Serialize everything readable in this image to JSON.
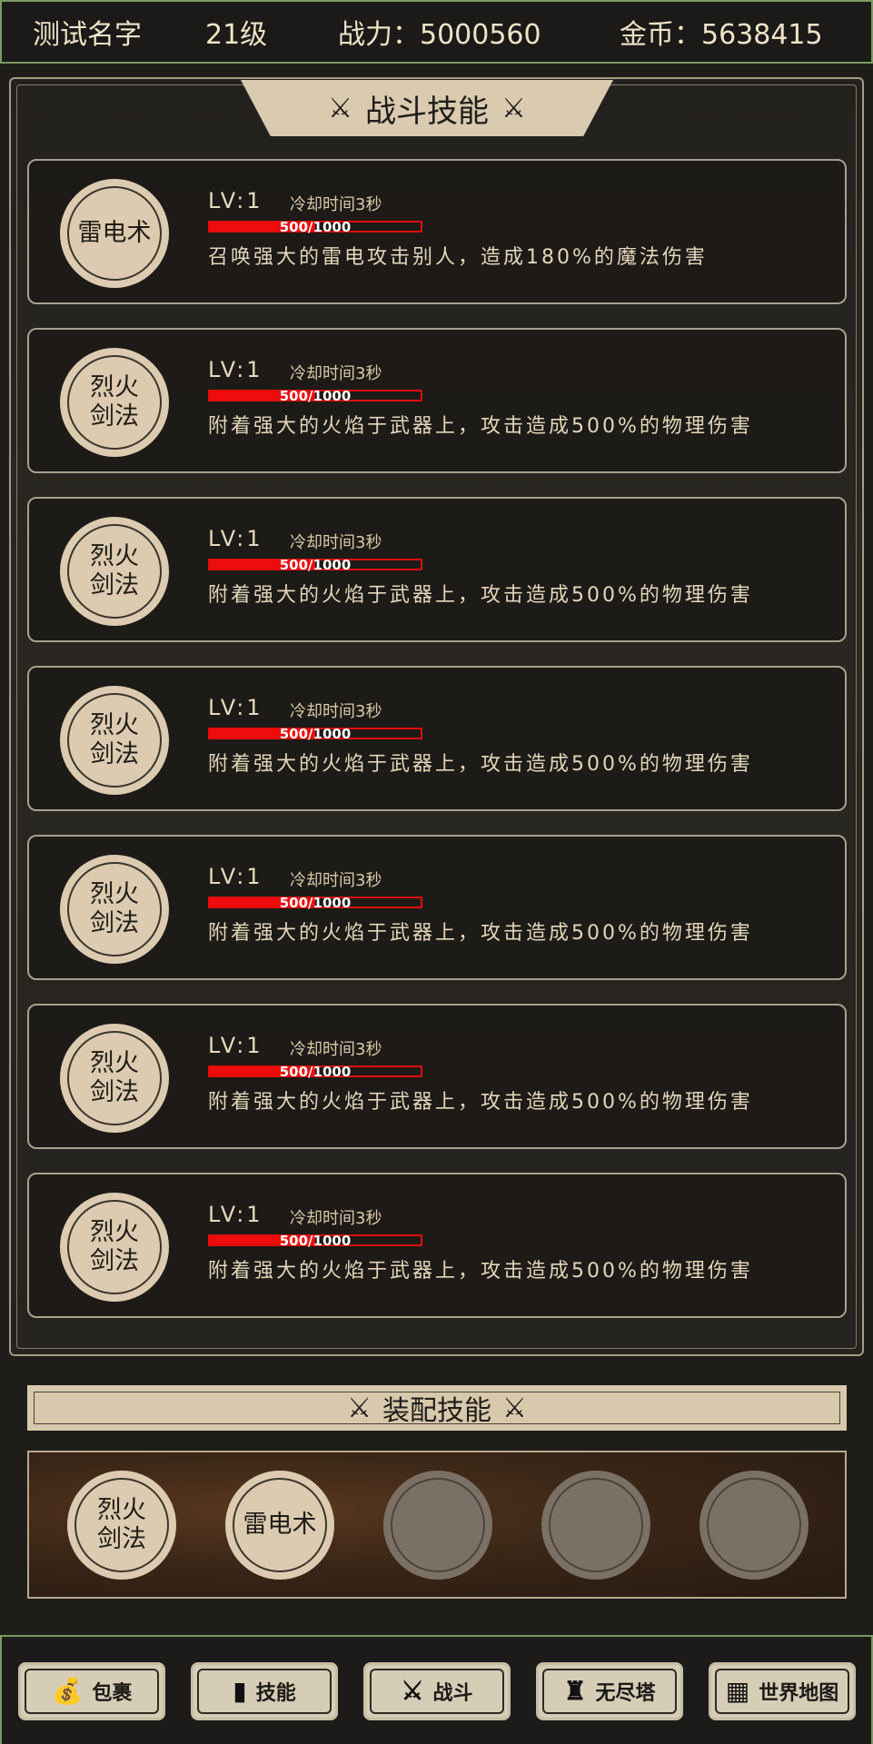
{
  "header": {
    "name": "测试名字",
    "level": "21级",
    "power": "战力：5000560",
    "gold": "金币：5638415"
  },
  "battle_skills": {
    "title": "战斗技能",
    "items": [
      {
        "icon_label": "雷电术",
        "level": "LV:1",
        "cooldown": "冷却时间3秒",
        "progress_text": "500/1000",
        "progress": 0.5,
        "description": "召唤强大的雷电攻击别人，造成180%的魔法伤害"
      },
      {
        "icon_label": "烈火剑法",
        "level": "LV:1",
        "cooldown": "冷却时间3秒",
        "progress_text": "500/1000",
        "progress": 0.5,
        "description": "附着强大的火焰于武器上，攻击造成500%的物理伤害"
      },
      {
        "icon_label": "烈火剑法",
        "level": "LV:1",
        "cooldown": "冷却时间3秒",
        "progress_text": "500/1000",
        "progress": 0.5,
        "description": "附着强大的火焰于武器上，攻击造成500%的物理伤害"
      },
      {
        "icon_label": "烈火剑法",
        "level": "LV:1",
        "cooldown": "冷却时间3秒",
        "progress_text": "500/1000",
        "progress": 0.5,
        "description": "附着强大的火焰于武器上，攻击造成500%的物理伤害"
      },
      {
        "icon_label": "烈火剑法",
        "level": "LV:1",
        "cooldown": "冷却时间3秒",
        "progress_text": "500/1000",
        "progress": 0.5,
        "description": "附着强大的火焰于武器上，攻击造成500%的物理伤害"
      },
      {
        "icon_label": "烈火剑法",
        "level": "LV:1",
        "cooldown": "冷却时间3秒",
        "progress_text": "500/1000",
        "progress": 0.5,
        "description": "附着强大的火焰于武器上，攻击造成500%的物理伤害"
      },
      {
        "icon_label": "烈火剑法",
        "level": "LV:1",
        "cooldown": "冷却时间3秒",
        "progress_text": "500/1000",
        "progress": 0.5,
        "description": "附着强大的火焰于武器上，攻击造成500%的物理伤害"
      }
    ]
  },
  "equipped": {
    "title": "装配技能",
    "slots": [
      {
        "label": "烈火剑法",
        "empty": false
      },
      {
        "label": "雷电术",
        "empty": false
      },
      {
        "label": "",
        "empty": true
      },
      {
        "label": "",
        "empty": true
      },
      {
        "label": "",
        "empty": true
      }
    ]
  },
  "nav": [
    {
      "label": "包裹",
      "icon": "bag-icon"
    },
    {
      "label": "技能",
      "icon": "book-icon"
    },
    {
      "label": "战斗",
      "icon": "crossed-swords-icon"
    },
    {
      "label": "无尽塔",
      "icon": "tower-icon"
    },
    {
      "label": "世界地图",
      "icon": "map-icon"
    }
  ],
  "colors": {
    "background": "#1f1d1a",
    "parchment": "#d9cab0",
    "progress_red": "#ee0c0c",
    "frame_green": "#7a9b62"
  }
}
